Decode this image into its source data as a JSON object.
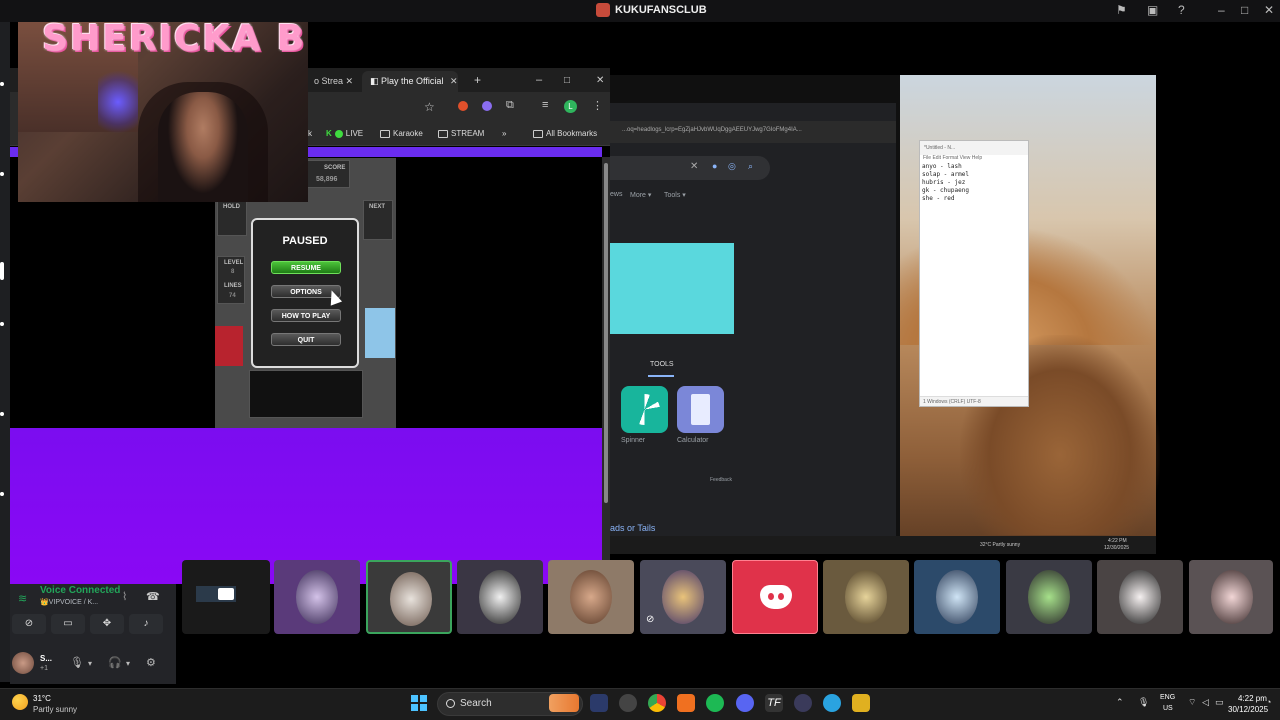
{
  "discord": {
    "window_title": "KUKUFANSCLUB",
    "voice_status": "Voice Connected",
    "voice_channel": "👑VIPVOICE / K...",
    "user_name": "S...",
    "user_sub": "+1"
  },
  "stream": {
    "overlay_name": "SHERICKA B"
  },
  "browser": {
    "tabs": [
      {
        "label": "o Strea"
      },
      {
        "label": "Play the Official"
      }
    ],
    "bookmarks": {
      "k": "k",
      "live": "LIVE",
      "karaoke": "Karaoke",
      "stream": "STREAM",
      "more": "»",
      "all": "All Bookmarks"
    }
  },
  "game": {
    "score_label": "SCORE",
    "score_value": "58,896",
    "hold_label": "HOLD",
    "next_label": "NEXT",
    "level_label": "LEVEL",
    "level_value": "8",
    "lines_label": "LINES",
    "lines_value": "74",
    "pause_title": "PAUSED",
    "buttons": {
      "resume": "RESUME",
      "options": "OPTIONS",
      "how_to_play": "HOW TO PLAY",
      "quit": "QUIT"
    }
  },
  "inner_screen": {
    "address": "...oq=headlogs_lcrp=EgZjaHJvbWUqDggAEEUYJwg7GIoFMg4IA...",
    "search_tabs": {
      "news": "ews",
      "more": "More ▾",
      "tools": "Tools ▾"
    },
    "tools_heading": "TOOLS",
    "tool_items": {
      "spinner": "Spinner",
      "calculator": "Calculator"
    },
    "feedback": "Feedback",
    "result_link": "ads or Tails",
    "notepad": {
      "title": "*Untitled - N...",
      "menu": "File  Edit  Format  View  Help",
      "text": "anyo - lash\nsolap - armel\nhubris - jez\ngk - chupaeng\nshe - red",
      "status": "1  Windows (CRLF)   UTF-8"
    },
    "taskbar": {
      "weather": "32°C  Partly sunny",
      "time": "4:22 PM",
      "date": "12/30/2025"
    }
  },
  "taskbar": {
    "weather_temp": "31°C",
    "weather_desc": "Partly sunny",
    "search": "Search",
    "lang1": "ENG",
    "lang2": "US",
    "time": "4:22 pm",
    "date": "30/12/2025"
  },
  "colors": {
    "purple_band": "#6a2cf0",
    "purple_bottom": "#8a08f5",
    "discord_red": "#e0324a",
    "voice_green": "#23a55a"
  }
}
